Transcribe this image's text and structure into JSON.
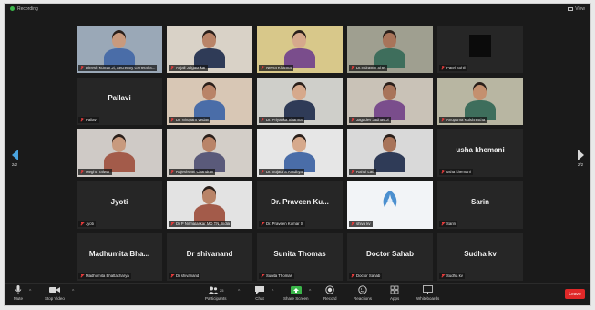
{
  "topbar": {
    "recording_label": "Recording",
    "view_label": "View"
  },
  "nav": {
    "left_page": "2/2",
    "right_page": "2/2"
  },
  "tiles": [
    {
      "name": "Dinesh Kumar Ji, Secretary General S...",
      "title": "",
      "video": true,
      "active": true,
      "bg": "#9aa8b7"
    },
    {
      "name": "Anjali Jalgaonkar",
      "title": "",
      "video": true,
      "active": false,
      "bg": "#d9d2c7"
    },
    {
      "name": "Neera Khanna",
      "title": "",
      "video": true,
      "active": false,
      "bg": "#d8c88a"
    },
    {
      "name": "Dr.Indrasen Shet",
      "title": "",
      "video": true,
      "active": false,
      "bg": "#9f9f90"
    },
    {
      "name": "Patel Sohil",
      "title": "",
      "video": true,
      "active": false,
      "bg": "#262626"
    },
    {
      "name": "Pallavi",
      "title": "Pallavi",
      "video": false,
      "active": false,
      "bg": "#262626"
    },
    {
      "name": "Dr. Nirupam Vedan",
      "title": "",
      "video": true,
      "active": false,
      "bg": "#d8c7b5"
    },
    {
      "name": "Dr. Priyanka Sharma",
      "title": "",
      "video": true,
      "active": false,
      "bg": "#cfcfca"
    },
    {
      "name": "Jagadev Jadhav Ji",
      "title": "",
      "video": true,
      "active": false,
      "bg": "#c9c2b7"
    },
    {
      "name": "Anupama Kulshrestha",
      "title": "",
      "video": true,
      "active": false,
      "bg": "#b8b6a2"
    },
    {
      "name": "Megha Talwar",
      "title": "",
      "video": true,
      "active": false,
      "bg": "#cfcac6"
    },
    {
      "name": "Rajeshwari Chandran",
      "title": "",
      "video": true,
      "active": false,
      "bg": "#d3cec8"
    },
    {
      "name": "Dr. Sujata S Aradhya",
      "title": "",
      "video": true,
      "active": false,
      "bg": "#e6e6e6"
    },
    {
      "name": "Rahul Lad",
      "title": "",
      "video": true,
      "active": false,
      "bg": "#d9d9d9"
    },
    {
      "name": "usha khemani",
      "title": "usha khemani",
      "video": false,
      "active": false,
      "bg": "#262626"
    },
    {
      "name": "Jyoti",
      "title": "Jyoti",
      "video": false,
      "active": false,
      "bg": "#262626"
    },
    {
      "name": "Dr P Nirmalaskar MD TN, India",
      "title": "",
      "video": true,
      "active": false,
      "bg": "#e3e3e3"
    },
    {
      "name": "Dr. Praveen Kumar S",
      "title": "Dr. Praveen  Ku...",
      "video": false,
      "active": false,
      "bg": "#262626"
    },
    {
      "name": "shiva kv",
      "title": "",
      "video": true,
      "active": false,
      "bg": "#f2f4f7"
    },
    {
      "name": "Sarin",
      "title": "Sarin",
      "video": false,
      "active": false,
      "bg": "#262626"
    },
    {
      "name": "Madhumita Bhattacharya",
      "title": "Madhumita  Bha...",
      "video": false,
      "active": false,
      "bg": "#262626"
    },
    {
      "name": "Dr shivanand",
      "title": "Dr shivanand",
      "video": false,
      "active": false,
      "bg": "#262626"
    },
    {
      "name": "Sunita Thomas",
      "title": "Sunita Thomas",
      "video": false,
      "active": false,
      "bg": "#262626"
    },
    {
      "name": "Doctor Sahab",
      "title": "Doctor Sahab",
      "video": false,
      "active": false,
      "bg": "#262626"
    },
    {
      "name": "Sudha kv",
      "title": "Sudha kv",
      "video": false,
      "active": false,
      "bg": "#262626"
    }
  ],
  "toolbar": {
    "mute": "Mute",
    "stop_video": "Stop Video",
    "participants": "Participants",
    "participants_count": "25",
    "chat": "Chat",
    "share_screen": "Share Screen",
    "record": "Record",
    "reactions": "Reactions",
    "apps": "Apps",
    "whiteboards": "Whiteboards",
    "leave": "Leave"
  },
  "colors": {
    "share_green": "#3bb54a",
    "leave_red": "#e02828",
    "active_speaker": "#d8cf3a",
    "muted_red": "#e23b3b"
  }
}
